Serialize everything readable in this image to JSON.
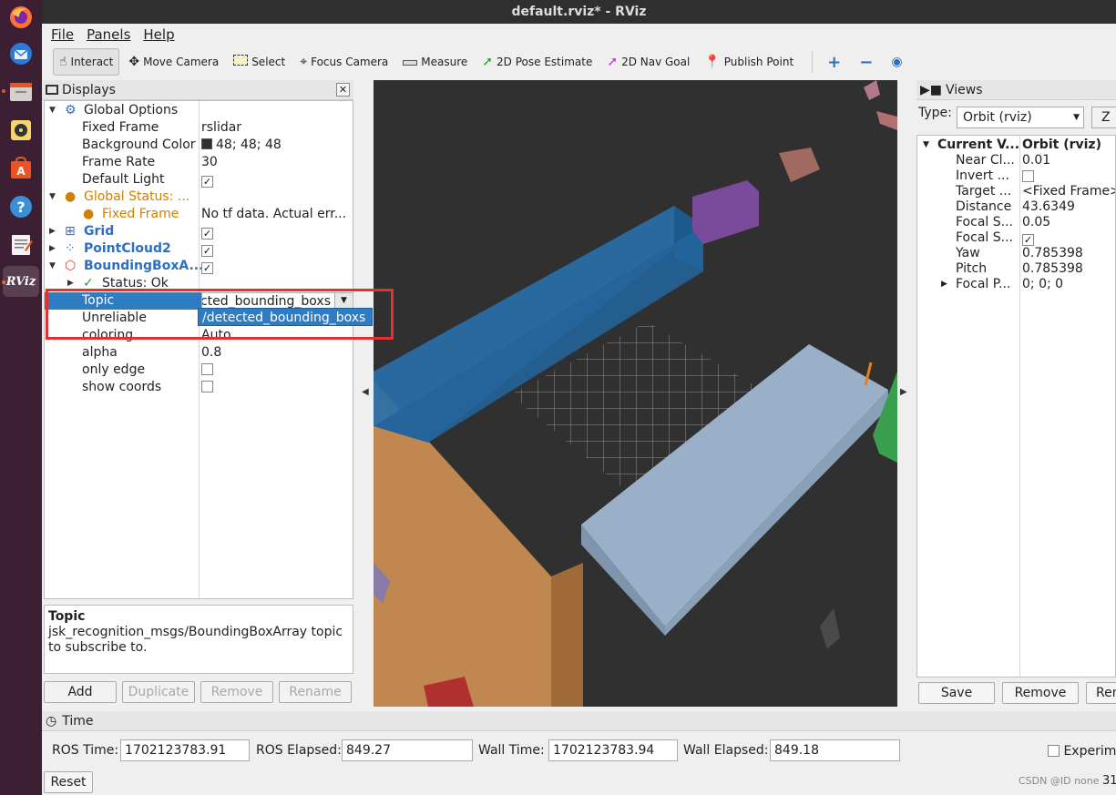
{
  "window": {
    "title": "default.rviz* - RViz"
  },
  "dock": {
    "icons": [
      "firefox-icon",
      "thunderbird-icon",
      "files-icon",
      "rhythmbox-icon",
      "software-icon",
      "help-icon",
      "text-editor-icon",
      "rviz-icon"
    ],
    "rviz_label": "RViz"
  },
  "menu": {
    "file": "File",
    "panels": "Panels",
    "help": "Help"
  },
  "toolbar": {
    "interact": "Interact",
    "move_camera": "Move Camera",
    "select": "Select",
    "focus_camera": "Focus Camera",
    "measure": "Measure",
    "pose_estimate": "2D Pose Estimate",
    "nav_goal": "2D Nav Goal",
    "publish_point": "Publish Point"
  },
  "displays": {
    "title": "Displays",
    "global_options": "Global Options",
    "fixed_frame_label": "Fixed Frame",
    "fixed_frame_value": "rslidar",
    "bg_color_label": "Background Color",
    "bg_color_value": "48; 48; 48",
    "frame_rate_label": "Frame Rate",
    "frame_rate_value": "30",
    "default_light_label": "Default Light",
    "global_status": "Global Status: ...",
    "gs_fixed_frame": "Fixed Frame",
    "gs_fixed_frame_value": "No tf data.  Actual err...",
    "grid": "Grid",
    "pointcloud": "PointCloud2",
    "bbox": "BoundingBoxA...",
    "status_ok": "Status: Ok",
    "topic_label": "Topic",
    "topic_value": "/detected_bounding_boxs",
    "topic_value_clipped": "ected_bounding_boxs",
    "unreliable_label": "Unreliable",
    "coloring_label": "coloring",
    "coloring_value": "Auto",
    "alpha_label": "alpha",
    "alpha_value": "0.8",
    "only_edge_label": "only edge",
    "show_coords_label": "show coords",
    "desc_title": "Topic",
    "desc_text": "jsk_recognition_msgs/BoundingBoxArray topic to subscribe to.",
    "add": "Add",
    "duplicate": "Duplicate",
    "remove": "Remove",
    "rename": "Rename"
  },
  "views": {
    "title": "Views",
    "type_label": "Type:",
    "type_value": "Orbit (rviz)",
    "zero": "Z",
    "current_view": "Current V...",
    "current_view_value": "Orbit (rviz)",
    "near_clip": "Near Cl...",
    "near_clip_value": "0.01",
    "invert": "Invert ...",
    "target": "Target ...",
    "target_value": "<Fixed Frame>",
    "distance": "Distance",
    "distance_value": "43.6349",
    "focal_s1": "Focal S...",
    "focal_s1_value": "0.05",
    "focal_s2": "Focal S...",
    "yaw": "Yaw",
    "yaw_value": "0.785398",
    "pitch": "Pitch",
    "pitch_value": "0.785398",
    "focal_p": "Focal P...",
    "focal_p_value": "0; 0; 0",
    "save": "Save",
    "remove": "Remove",
    "rename": "Ren"
  },
  "time": {
    "title": "Time",
    "ros_time_label": "ROS Time:",
    "ros_time_value": "1702123783.91",
    "ros_elapsed_label": "ROS Elapsed:",
    "ros_elapsed_value": "849.27",
    "wall_time_label": "Wall Time:",
    "wall_time_value": "1702123783.94",
    "wall_elapsed_label": "Wall Elapsed:",
    "wall_elapsed_value": "849.18",
    "experimental": "Experim",
    "reset": "Reset",
    "fps": "31"
  },
  "watermark": "CSDN @ID none",
  "colors": {
    "dock_bg": "#3c1f33",
    "selection": "#2f7cc2",
    "highlight_box": "#e53030",
    "viewport_bg": "#303030"
  }
}
